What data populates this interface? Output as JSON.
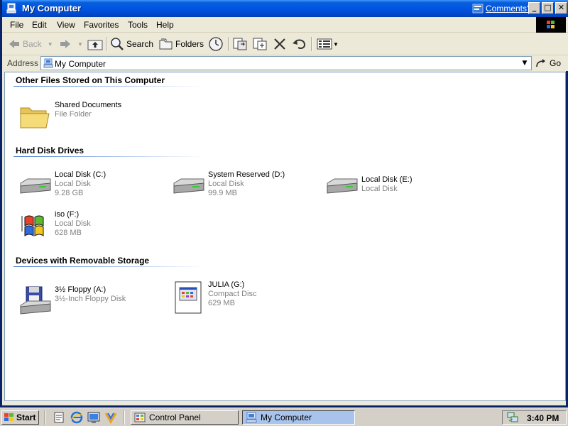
{
  "window": {
    "title": "My Computer",
    "comments_link": "Comments?",
    "controls": {
      "minimize": "_",
      "maximize": "□",
      "close": "✕"
    }
  },
  "menu": [
    "File",
    "Edit",
    "View",
    "Favorites",
    "Tools",
    "Help"
  ],
  "toolbar": {
    "back": "Back",
    "search": "Search",
    "folders": "Folders"
  },
  "address": {
    "label": "Address",
    "value": "My Computer",
    "go": "Go"
  },
  "groups": [
    {
      "header": "Other Files Stored on This Computer",
      "items": [
        {
          "name": "Shared Documents",
          "sub1": "File Folder",
          "sub2": "",
          "icon": "folder-icon"
        }
      ]
    },
    {
      "header": "Hard Disk Drives",
      "items": [
        {
          "name": "Local Disk (C:)",
          "sub1": "Local Disk",
          "sub2": "9.28 GB",
          "icon": "hard-disk-icon"
        },
        {
          "name": "System Reserved (D:)",
          "sub1": "Local Disk",
          "sub2": "99.9 MB",
          "icon": "hard-disk-icon"
        },
        {
          "name": "Local Disk (E:)",
          "sub1": "Local Disk",
          "sub2": "",
          "icon": "hard-disk-icon"
        },
        {
          "name": "iso (F:)",
          "sub1": "Local Disk",
          "sub2": "628 MB",
          "icon": "windows-flag-icon"
        }
      ]
    },
    {
      "header": "Devices with Removable Storage",
      "items": [
        {
          "name": "3½ Floppy (A:)",
          "sub1": "3½-Inch Floppy Disk",
          "sub2": "",
          "icon": "floppy-drive-icon"
        },
        {
          "name": "JULIA (G:)",
          "sub1": "Compact Disc",
          "sub2": "629 MB",
          "icon": "cd-autorun-icon"
        }
      ]
    }
  ],
  "taskbar": {
    "start": "Start",
    "tasks": [
      {
        "label": "Control Panel",
        "active": false
      },
      {
        "label": "My Computer",
        "active": true
      }
    ],
    "clock": "3:40 PM"
  },
  "colors": {
    "titlebar": "#0054e3",
    "chrome": "#ece9d8",
    "group_line": "#4a7fd4",
    "subtext": "#808080"
  }
}
